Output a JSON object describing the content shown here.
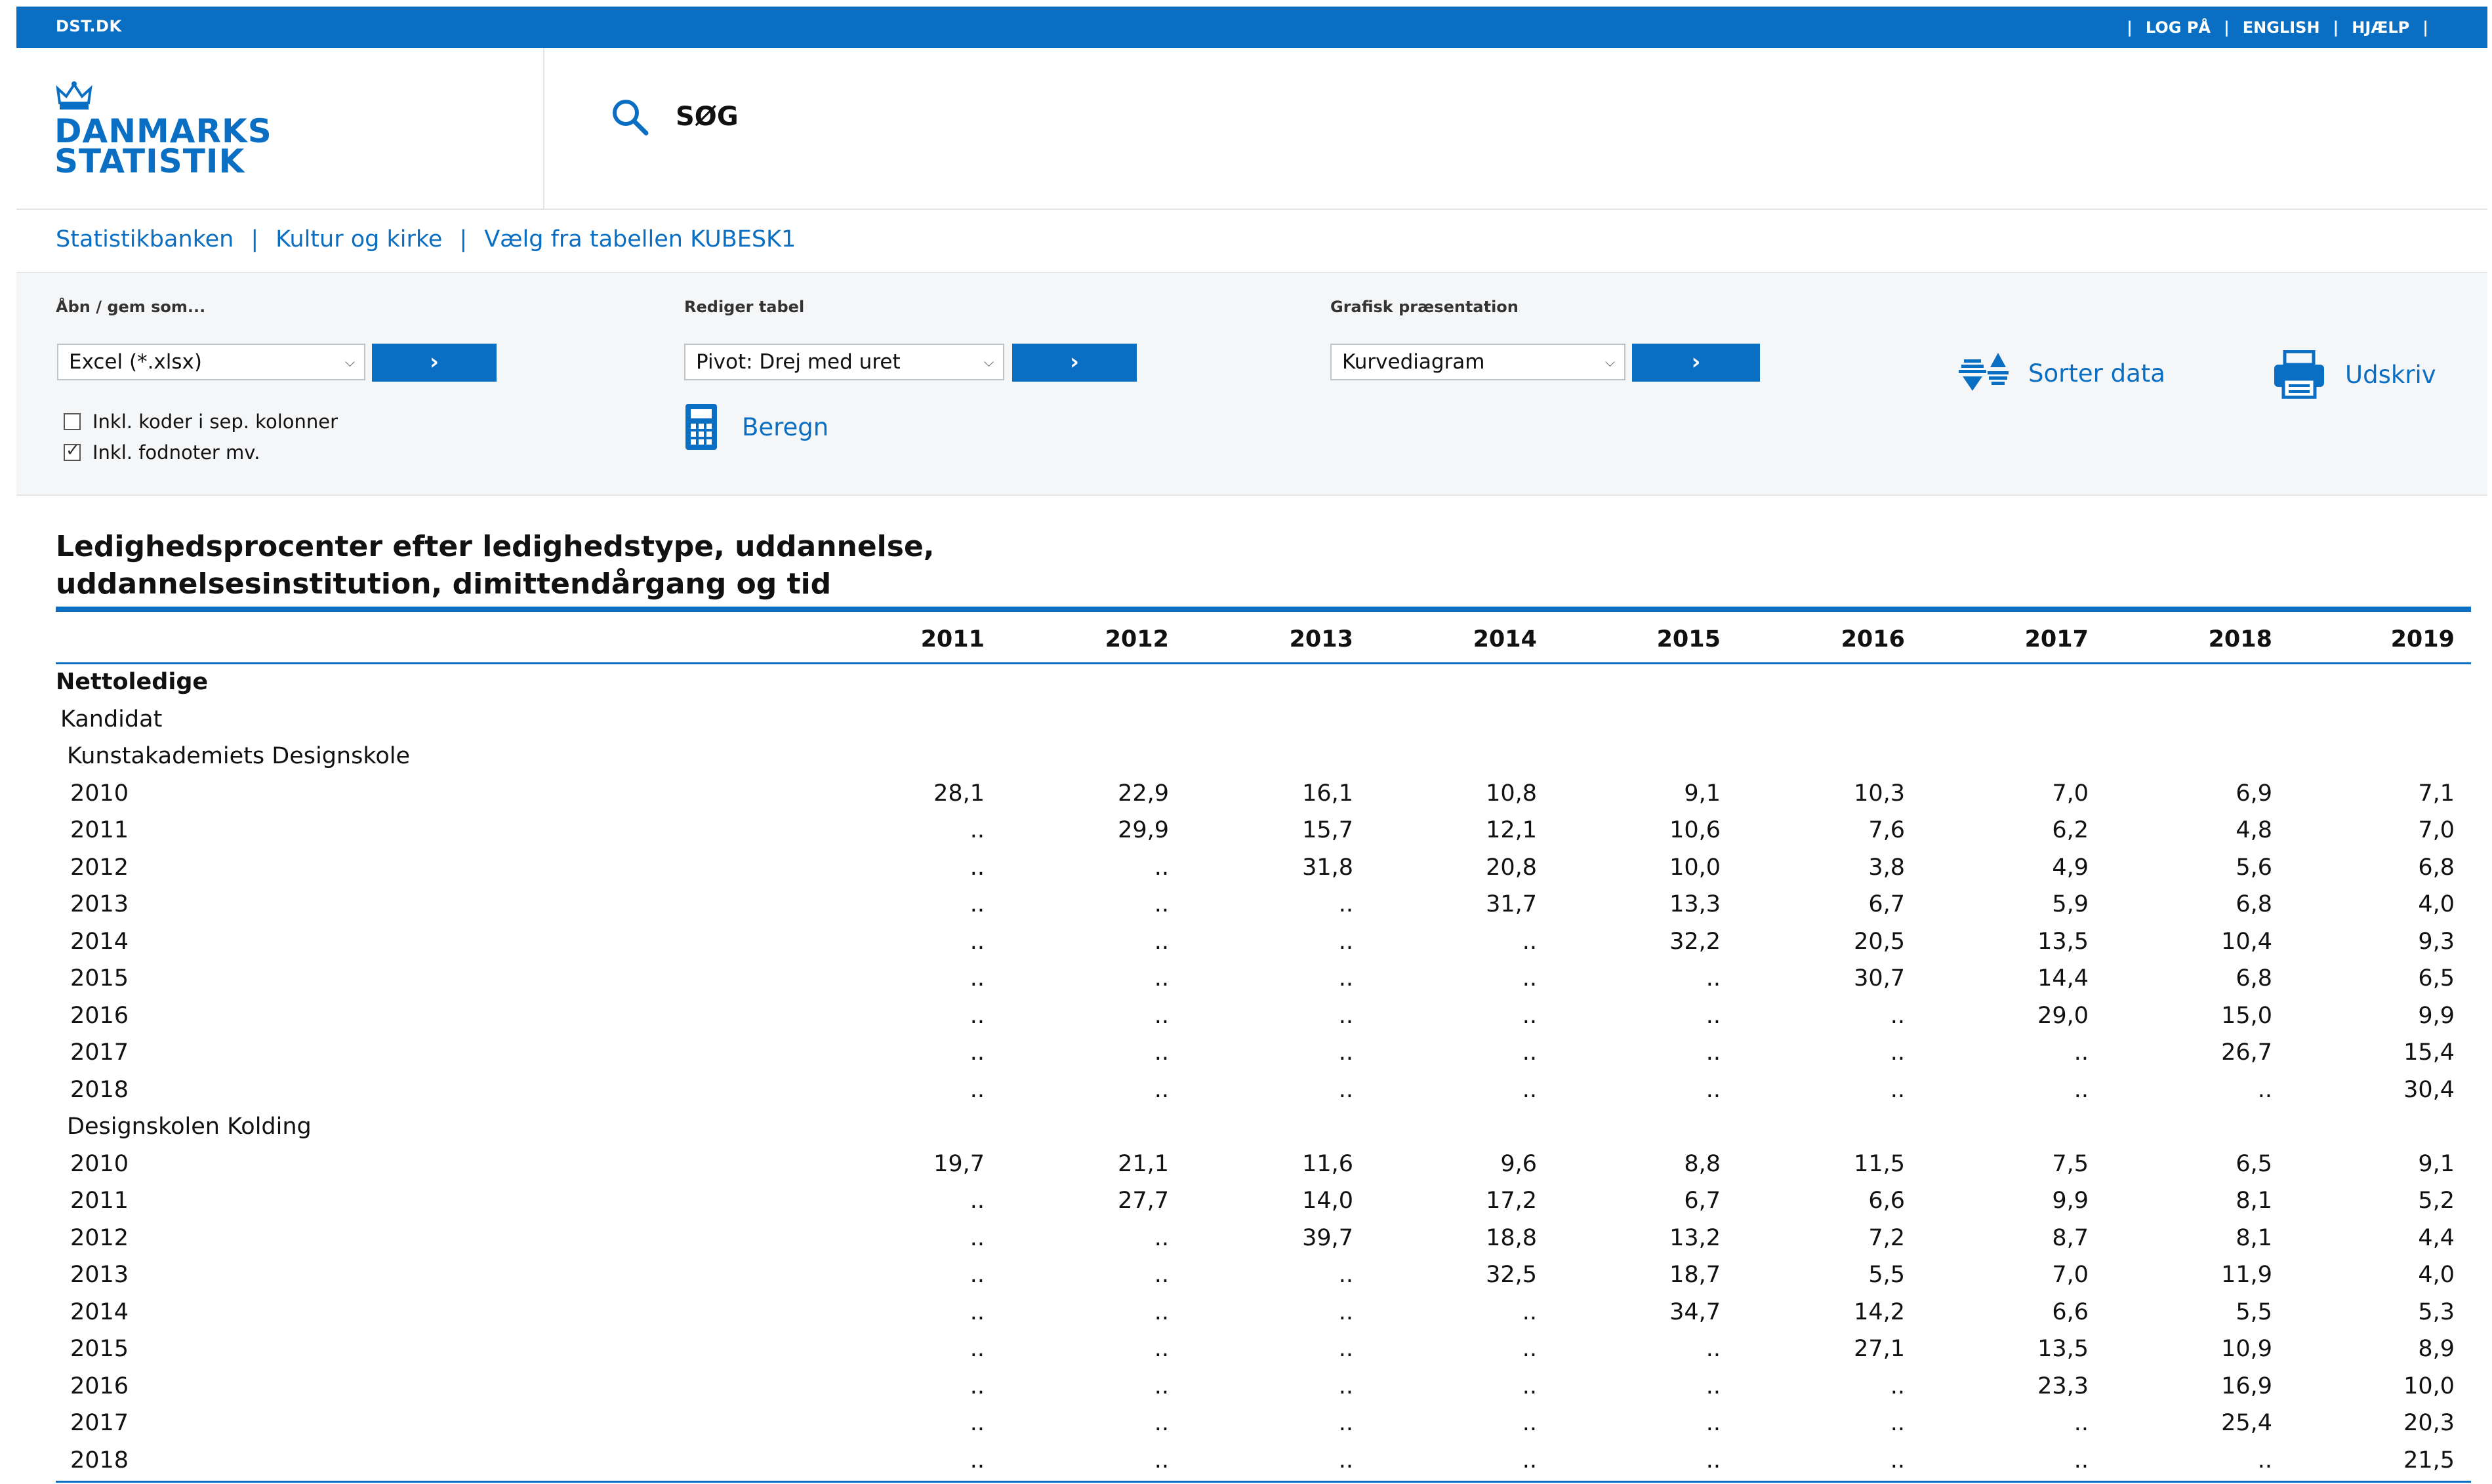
{
  "topbar": {
    "site": "DST.DK",
    "links": [
      "LOG PÅ",
      "ENGLISH",
      "HJÆLP"
    ]
  },
  "logo": {
    "line1": "DANMARKS",
    "line2": "STATISTIK"
  },
  "search": {
    "label": "SØG"
  },
  "breadcrumb": [
    "Statistikbanken",
    "Kultur og kirke",
    "Vælg fra tabellen KUBESK1"
  ],
  "toolbar": {
    "open_label": "Åbn / gem som...",
    "open_select": "Excel (*.xlsx)",
    "edit_label": "Rediger tabel",
    "edit_select": "Pivot: Drej med uret",
    "graph_label": "Grafisk præsentation",
    "graph_select": "Kurvediagram",
    "go": "›",
    "check1": "Inkl. koder i sep. kolonner",
    "check2": "Inkl. fodnoter mv.",
    "calc": "Beregn",
    "sort": "Sorter data",
    "print": "Udskriv"
  },
  "colors": {
    "accent": "#0a6fc2",
    "toolbar_bg": "#f5f6f8"
  },
  "table": {
    "title_line1": "Ledighedsprocenter efter ledighedstype, uddannelse,",
    "title_line2": "uddannelsesinstitution, dimittendårgang og tid",
    "years": [
      "2011",
      "2012",
      "2013",
      "2014",
      "2015",
      "2016",
      "2017",
      "2018",
      "2019"
    ],
    "type": "Nettoledige",
    "education": "Kandidat",
    "groups": [
      {
        "name": "Kunstakademiets Designskole",
        "rows": [
          {
            "label": "2010",
            "values": [
              "28,1",
              "22,9",
              "16,1",
              "10,8",
              "9,1",
              "10,3",
              "7,0",
              "6,9",
              "7,1"
            ]
          },
          {
            "label": "2011",
            "values": [
              "..",
              "29,9",
              "15,7",
              "12,1",
              "10,6",
              "7,6",
              "6,2",
              "4,8",
              "7,0"
            ]
          },
          {
            "label": "2012",
            "values": [
              "..",
              "..",
              "31,8",
              "20,8",
              "10,0",
              "3,8",
              "4,9",
              "5,6",
              "6,8"
            ]
          },
          {
            "label": "2013",
            "values": [
              "..",
              "..",
              "..",
              "31,7",
              "13,3",
              "6,7",
              "5,9",
              "6,8",
              "4,0"
            ]
          },
          {
            "label": "2014",
            "values": [
              "..",
              "..",
              "..",
              "..",
              "32,2",
              "20,5",
              "13,5",
              "10,4",
              "9,3"
            ]
          },
          {
            "label": "2015",
            "values": [
              "..",
              "..",
              "..",
              "..",
              "..",
              "30,7",
              "14,4",
              "6,8",
              "6,5"
            ]
          },
          {
            "label": "2016",
            "values": [
              "..",
              "..",
              "..",
              "..",
              "..",
              "..",
              "29,0",
              "15,0",
              "9,9"
            ]
          },
          {
            "label": "2017",
            "values": [
              "..",
              "..",
              "..",
              "..",
              "..",
              "..",
              "..",
              "26,7",
              "15,4"
            ]
          },
          {
            "label": "2018",
            "values": [
              "..",
              "..",
              "..",
              "..",
              "..",
              "..",
              "..",
              "..",
              "30,4"
            ]
          }
        ]
      },
      {
        "name": "Designskolen Kolding",
        "rows": [
          {
            "label": "2010",
            "values": [
              "19,7",
              "21,1",
              "11,6",
              "9,6",
              "8,8",
              "11,5",
              "7,5",
              "6,5",
              "9,1"
            ]
          },
          {
            "label": "2011",
            "values": [
              "..",
              "27,7",
              "14,0",
              "17,2",
              "6,7",
              "6,6",
              "9,9",
              "8,1",
              "5,2"
            ]
          },
          {
            "label": "2012",
            "values": [
              "..",
              "..",
              "39,7",
              "18,8",
              "13,2",
              "7,2",
              "8,7",
              "8,1",
              "4,4"
            ]
          },
          {
            "label": "2013",
            "values": [
              "..",
              "..",
              "..",
              "32,5",
              "18,7",
              "5,5",
              "7,0",
              "11,9",
              "4,0"
            ]
          },
          {
            "label": "2014",
            "values": [
              "..",
              "..",
              "..",
              "..",
              "34,7",
              "14,2",
              "6,6",
              "5,5",
              "5,3"
            ]
          },
          {
            "label": "2015",
            "values": [
              "..",
              "..",
              "..",
              "..",
              "..",
              "27,1",
              "13,5",
              "10,9",
              "8,9"
            ]
          },
          {
            "label": "2016",
            "values": [
              "..",
              "..",
              "..",
              "..",
              "..",
              "..",
              "23,3",
              "16,9",
              "10,0"
            ]
          },
          {
            "label": "2017",
            "values": [
              "..",
              "..",
              "..",
              "..",
              "..",
              "..",
              "..",
              "25,4",
              "20,3"
            ]
          },
          {
            "label": "2018",
            "values": [
              "..",
              "..",
              "..",
              "..",
              "..",
              "..",
              "..",
              "..",
              "21,5"
            ]
          }
        ]
      }
    ]
  }
}
